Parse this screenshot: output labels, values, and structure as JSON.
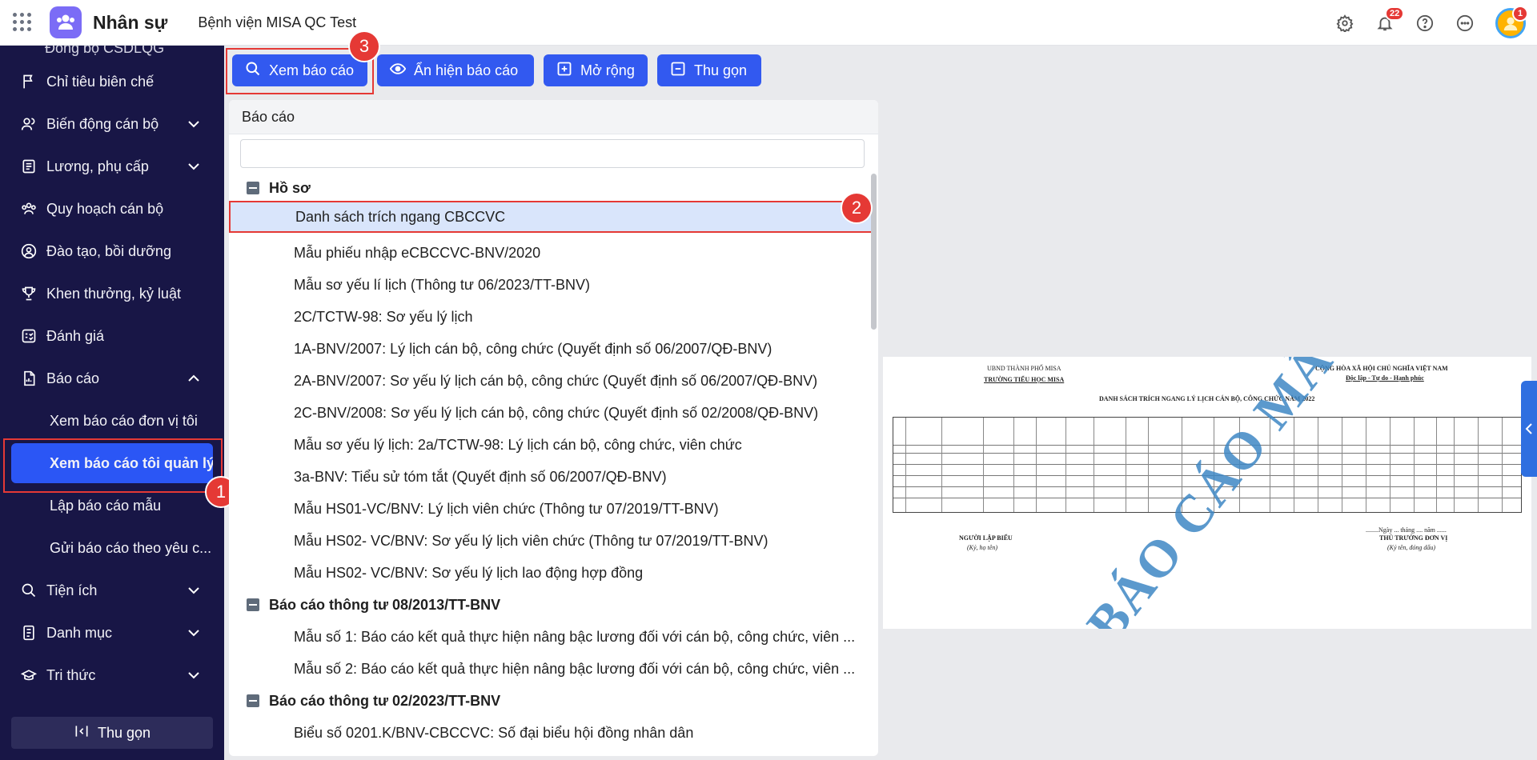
{
  "header": {
    "app_name": "Nhân sự",
    "org_name": "Bệnh viện MISA QC Test",
    "notification_count": "22",
    "avatar_badge": "1"
  },
  "sidebar": {
    "cut_item": "Đồng bộ CSDLQG",
    "items": [
      {
        "label": "Chỉ tiêu biên chế",
        "icon": "flag-icon"
      },
      {
        "label": "Biến động cán bộ",
        "icon": "people-icon"
      },
      {
        "label": "Lương, phụ cấp",
        "icon": "payroll-icon"
      },
      {
        "label": "Quy hoạch cán bộ",
        "icon": "group-icon"
      },
      {
        "label": "Đào tạo, bồi dưỡng",
        "icon": "training-icon"
      },
      {
        "label": "Khen thưởng, kỷ luật",
        "icon": "trophy-icon"
      },
      {
        "label": "Đánh giá",
        "icon": "rating-icon"
      },
      {
        "label": "Báo cáo",
        "icon": "report-icon"
      }
    ],
    "report_sub": [
      "Xem báo cáo đơn vị tôi",
      "Xem báo cáo tôi quản lý",
      "Lập báo cáo mẫu",
      "Gửi báo cáo theo yêu c..."
    ],
    "bottom_items": [
      {
        "label": "Tiện ích",
        "icon": "search-icon"
      },
      {
        "label": "Danh mục",
        "icon": "catalog-icon"
      },
      {
        "label": "Tri thức",
        "icon": "knowledge-icon"
      }
    ],
    "collapse_label": "Thu gọn"
  },
  "toolbar": {
    "view_report": "Xem báo cáo",
    "toggle_report": "Ẩn hiện báo cáo",
    "expand": "Mở rộng",
    "collapse": "Thu gọn"
  },
  "panel": {
    "title": "Báo cáo",
    "groups": [
      {
        "label": "Hồ sơ",
        "items": [
          "Danh sách trích ngang CBCCVC",
          "Mẫu phiếu nhập eCBCCVC-BNV/2020",
          "Mẫu sơ yếu lí lịch (Thông tư 06/2023/TT-BNV)",
          "2C/TCTW-98: Sơ yếu lý lịch",
          "1A-BNV/2007: Lý lịch cán bộ, công chức (Quyết định số 06/2007/QĐ-BNV)",
          "2A-BNV/2007: Sơ yếu lý lịch cán bộ, công chức (Quyết định số 06/2007/QĐ-BNV)",
          "2C-BNV/2008: Sơ yếu lý lịch cán bộ, công chức (Quyết định số 02/2008/QĐ-BNV)",
          "Mẫu sơ yếu lý lịch: 2a/TCTW-98: Lý lịch cán bộ, công chức, viên chức",
          "3a-BNV: Tiểu sử tóm tắt (Quyết định số 06/2007/QĐ-BNV)",
          "Mẫu HS01-VC/BNV: Lý lịch viên chức (Thông tư 07/2019/TT-BNV)",
          "Mẫu HS02- VC/BNV: Sơ yếu lý lịch viên chức (Thông tư 07/2019/TT-BNV)",
          "Mẫu HS02- VC/BNV: Sơ yếu lý lịch lao động hợp đồng"
        ]
      },
      {
        "label": "Báo cáo thông tư 08/2013/TT-BNV",
        "items": [
          "Mẫu số 1: Báo cáo kết quả thực hiện nâng bậc lương đối với cán bộ, công chức, viên ...",
          "Mẫu số 2: Báo cáo kết quả thực hiện nâng bậc lương đối với cán bộ, công chức, viên ..."
        ]
      },
      {
        "label": "Báo cáo thông tư 02/2023/TT-BNV",
        "items": [
          "Biểu số 0201.K/BNV-CBCCVC: Số đại biểu hội đồng nhân dân"
        ]
      }
    ]
  },
  "markers": [
    "1",
    "2",
    "3"
  ],
  "preview": {
    "org_line": "UBND THÀNH PHỐ MISA",
    "school": "TRƯỜNG TIỂU HỌC MISA",
    "nation": "CỘNG HÒA XÃ HỘI CHỦ NGHĨA VIỆT NAM",
    "motto": "Độc lập - Tự do - Hạnh phúc",
    "title": "DANH SÁCH TRÍCH NGANG LÝ LỊCH CÁN BỘ, CÔNG CHỨC NĂM 2022",
    "date_line": "........Ngày ... tháng .... năm ......",
    "maker": "NGƯỜI LẬP BIỂU",
    "maker_sign": "(Ký, họ tên)",
    "head": "THỦ TRƯỞNG ĐƠN VỊ",
    "head_sign": "(Ký tên, đóng dấu)",
    "watermark": "BÁO CÁO MẪU"
  },
  "colors": {
    "sidebar_bg": "#181646",
    "primary": "#3259f0",
    "highlight": "#e53935"
  }
}
